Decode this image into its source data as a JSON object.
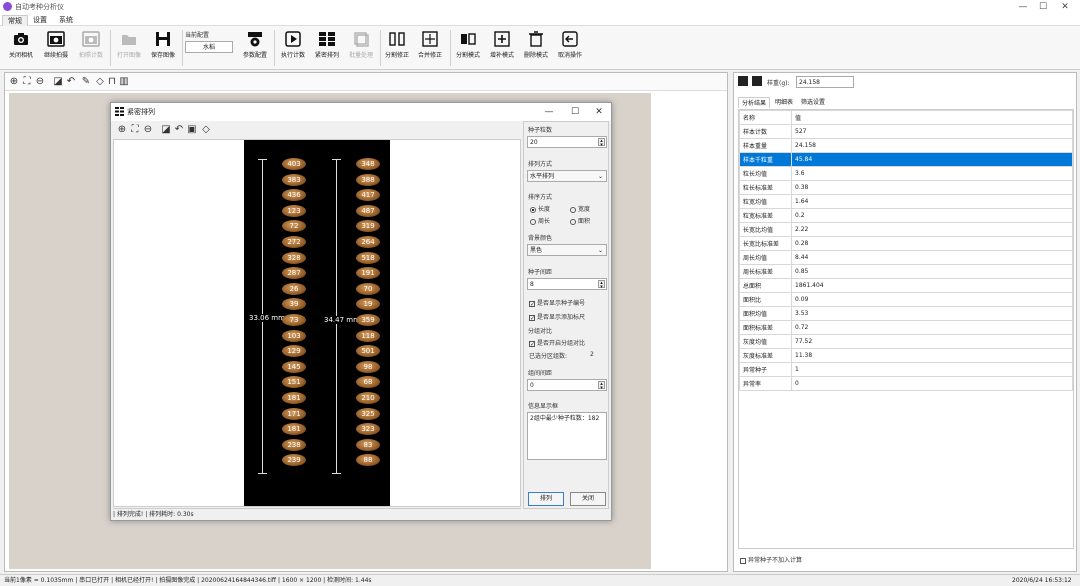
{
  "app": {
    "title": "自动考种分析仪",
    "win_controls": [
      "—",
      "☐",
      "✕"
    ]
  },
  "menu": {
    "tabs": [
      "常规",
      "设置",
      "系统"
    ],
    "active": 0
  },
  "ribbon": {
    "buttons": [
      {
        "label": "关闭相机",
        "icon": "camera-icon",
        "disabled": false
      },
      {
        "label": "继续拍摄",
        "icon": "camera-continue-icon",
        "disabled": false
      },
      {
        "label": "拍照计数",
        "icon": "camera-count-icon",
        "disabled": true
      },
      {
        "label": "打开图像",
        "icon": "folder-icon",
        "disabled": true
      },
      {
        "label": "保存图像",
        "icon": "save-icon",
        "disabled": false
      },
      {
        "label": "参数配置",
        "icon": "config-icon",
        "disabled": false
      },
      {
        "label": "执行计数",
        "icon": "play-icon",
        "disabled": false
      },
      {
        "label": "紧密排列",
        "icon": "grid-icon",
        "disabled": false
      },
      {
        "label": "批量处理",
        "icon": "batch-icon",
        "disabled": true
      },
      {
        "label": "分割修正",
        "icon": "split-fix-icon",
        "disabled": false
      },
      {
        "label": "合并修正",
        "icon": "merge-fix-icon",
        "disabled": false
      },
      {
        "label": "分割模式",
        "icon": "split-mode-icon",
        "disabled": false
      },
      {
        "label": "增补模式",
        "icon": "add-mode-icon",
        "disabled": false
      },
      {
        "label": "删除模式",
        "icon": "delete-mode-icon",
        "disabled": false
      },
      {
        "label": "取消操作",
        "icon": "cancel-op-icon",
        "disabled": false
      }
    ],
    "config": {
      "label": "当前配置",
      "value": "水稻"
    }
  },
  "dialog": {
    "title": "紧密排列",
    "controls": [
      "—",
      "☐",
      "✕"
    ],
    "seed_count_label": "种子粒数",
    "seed_count": "20",
    "arrange_label": "排列方式",
    "arrange_value": "水平排列",
    "sort_label": "排序方式",
    "sort_options": [
      "长度",
      "宽度",
      "周长",
      "面积"
    ],
    "sort_selected": "长度",
    "bg_label": "背景颜色",
    "bg_value": "黑色",
    "spacing_label": "种子间距",
    "spacing_value": "8",
    "show_id_label": "是否显示种子编号",
    "show_ruler_label": "是否显示添加标尺",
    "group_label": "分组对比",
    "group_enable_label": "是否开启分组对比",
    "groups_label": "已选分区组数:",
    "groups_value": "2",
    "group_gap_label": "组间间距",
    "group_gap_value": "0",
    "info_label": "信息显示框",
    "info_text": "2组中最少种子粒数：182",
    "btn_arrange": "排列",
    "btn_close": "关闭",
    "status": "| 排列完成!   | 排列耗时: 0.30s",
    "col1_mm": "33.06 mm",
    "col2_mm": "34.47 mm",
    "col1_ids": [
      "403",
      "383",
      "436",
      "123",
      "72",
      "272",
      "328",
      "287",
      "26",
      "39",
      "73",
      "103",
      "129",
      "145",
      "151",
      "181",
      "171",
      "181",
      "238",
      "239"
    ],
    "col2_ids": [
      "348",
      "388",
      "417",
      "487",
      "319",
      "264",
      "518",
      "191",
      "70",
      "19",
      "359",
      "118",
      "501",
      "98",
      "68",
      "210",
      "325",
      "323",
      "83",
      "88"
    ]
  },
  "right": {
    "weight_label": "样重(g):",
    "weight_value": "24.158",
    "tabs": [
      "分析结果",
      "明细表",
      "筛选设置"
    ],
    "active_tab": 0,
    "header": [
      "名称",
      "值"
    ],
    "rows": [
      [
        "样本计数",
        "527"
      ],
      [
        "样本重量",
        "24.158"
      ],
      [
        "样本千粒重",
        "45.84"
      ],
      [
        "粒长均值",
        "3.6"
      ],
      [
        "粒长标准差",
        "0.38"
      ],
      [
        "粒宽均值",
        "1.64"
      ],
      [
        "粒宽标准差",
        "0.2"
      ],
      [
        "长宽比均值",
        "2.22"
      ],
      [
        "长宽比标准差",
        "0.28"
      ],
      [
        "周长均值",
        "8.44"
      ],
      [
        "周长标准差",
        "0.85"
      ],
      [
        "总面积",
        "1861.404"
      ],
      [
        "面积比",
        "0.09"
      ],
      [
        "面积均值",
        "3.53"
      ],
      [
        "面积标准差",
        "0.72"
      ],
      [
        "灰度均值",
        "77.52"
      ],
      [
        "灰度标准差",
        "11.38"
      ],
      [
        "异常种子",
        "1"
      ],
      [
        "异常率",
        "0"
      ]
    ],
    "selected_row": 2,
    "footer_check": "异常种子不加入计算"
  },
  "status": {
    "left": "当前1像素 = 0.1035mm  | 串口已打开  | 相机已经打开!  | 拍摄图像完成  | 20200624164844346.tiff  | 1600 × 1200  | 检测时间: 1.44s",
    "right": "2020/6/24 16:53:12"
  }
}
